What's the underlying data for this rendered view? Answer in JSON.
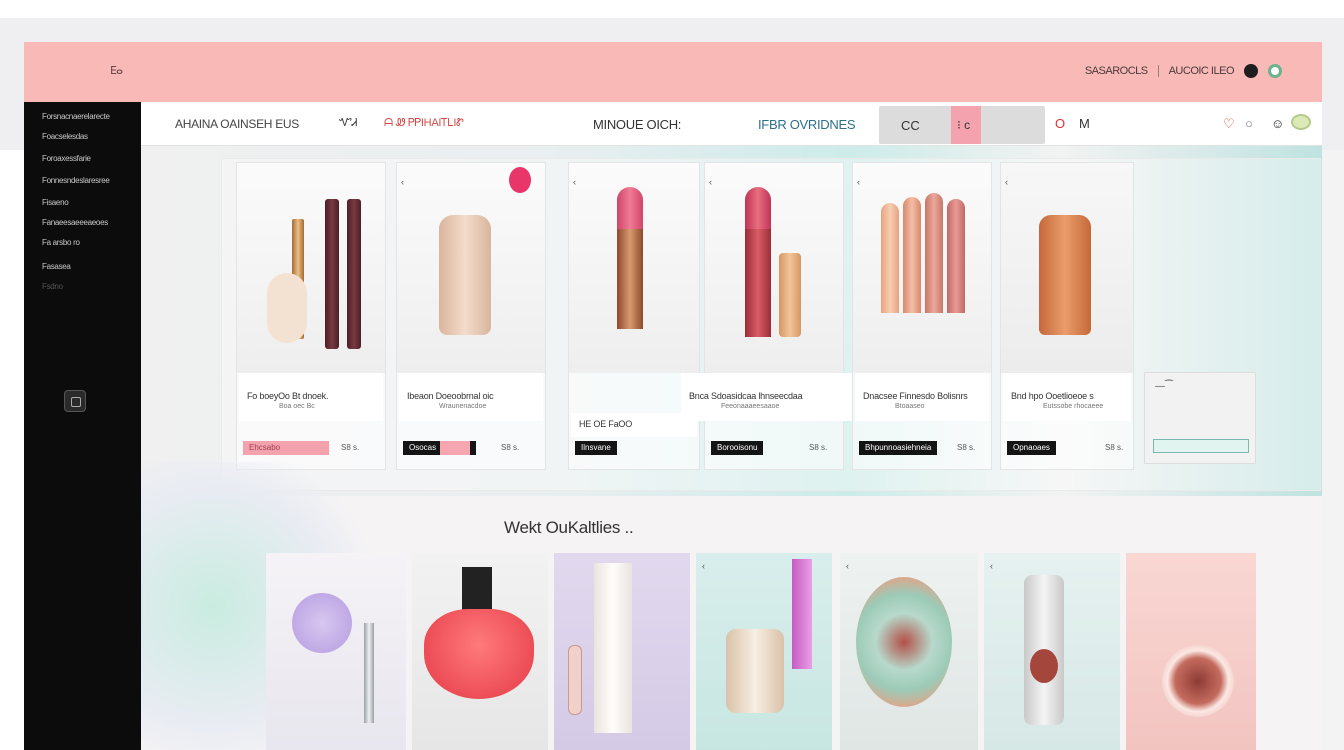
{
  "header": {
    "corner_mark": "ⴹⴰ",
    "links": [
      "SASAROCLS",
      "AUCOIC ILEO"
    ]
  },
  "sidebar": {
    "items": [
      "Forsnacnaerelarecte",
      "Foacselesdas",
      "Foroaxessfarie",
      "Fonnesndeslaresree",
      "Fisaeno",
      "Fanaeesaeeeaeoes",
      "Fa arsbo ro",
      "Fasasea",
      "Fsdno"
    ]
  },
  "navbar": {
    "left_text": "AHAINA OAINSEH EUS",
    "left_icon_text": "ᏉᏗ",
    "left_extra": "ᗩ  Ꮺ ᏢᏢIHAIᎢᏞIᏑ",
    "center_text": "MINOUE OICH:",
    "teal_text": "IFBR OVRIDNES",
    "search_value": "CC",
    "search_extra": "⁝ c",
    "right_icon_a": "O",
    "right_icon_b": "M"
  },
  "hero": {
    "cards": [
      {
        "title": "Fo boeyOo Bt dnoek.",
        "sub": "Boa oec Bc",
        "button": "Ehcsabo",
        "price": "S8 s."
      },
      {
        "title": "Ibeaon Doeoobrnal oic",
        "sub": "Wraunenacdoe",
        "button": "Osocas",
        "price": "S8 s."
      },
      {
        "title": "HE OE FaOO",
        "sub": "",
        "button": "Ilnsvane",
        "price": "S8 s."
      },
      {
        "title": "Bnca Sdoasidcaa lhnseecdaa",
        "sub": "Feeonaaaeesaaoe",
        "button": "Borooisonu",
        "price": "S8 s."
      },
      {
        "title": "Dnacsee Finnesdo Bolisnrs",
        "sub": "Btoaaseo",
        "button": "Bhpunnoasiehneia",
        "price": "S8 s."
      },
      {
        "title": "Bnd hpo Ooetlioeoe s",
        "sub": "Eutssobe rhocaeee",
        "button": "Opnaoaes",
        "price": "S8 s."
      }
    ]
  },
  "section": {
    "title": "Wekt OuKaltlies .."
  },
  "colors": {
    "header_pink": "#f8b9b7",
    "sidebar_black": "#0c0c0c",
    "accent_pink": "#f4a3ae",
    "mint": "#bfe3e0"
  }
}
